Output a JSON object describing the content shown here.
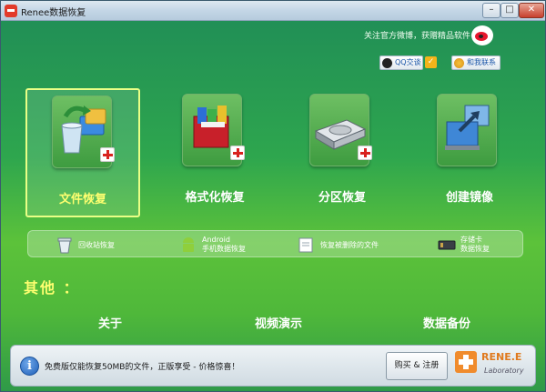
{
  "window": {
    "title": "Renee数据恢复"
  },
  "header": {
    "follow_text": "关注官方微博，获赠精品软件",
    "qq_label": "QQ交谈",
    "contact_label": "和我联系"
  },
  "tiles": [
    {
      "label": "文件恢复",
      "selected": true
    },
    {
      "label": "格式化恢复",
      "selected": false
    },
    {
      "label": "分区恢复",
      "selected": false
    },
    {
      "label": "创建镜像",
      "selected": false
    }
  ],
  "subitems": [
    {
      "line1": "回收站恢复",
      "line2": ""
    },
    {
      "line1": "Android",
      "line2": "手机数据恢复"
    },
    {
      "line1": "恢复被删除的文件",
      "line2": ""
    },
    {
      "line1": "存储卡",
      "line2": "数据恢复"
    }
  ],
  "other": {
    "title": "其他 ：",
    "links": [
      "关于",
      "视频演示",
      "数据备份"
    ]
  },
  "footer": {
    "notice": "免费版仅能恢复50MB的文件，正版享受 - 价格惊喜！",
    "buy_label": "购买 & 注册",
    "brand_name": "RENE.E",
    "brand_sub": "Laboratory"
  },
  "colors": {
    "accent_yellow": "#ffff70",
    "background_green": "#2ea64e"
  }
}
